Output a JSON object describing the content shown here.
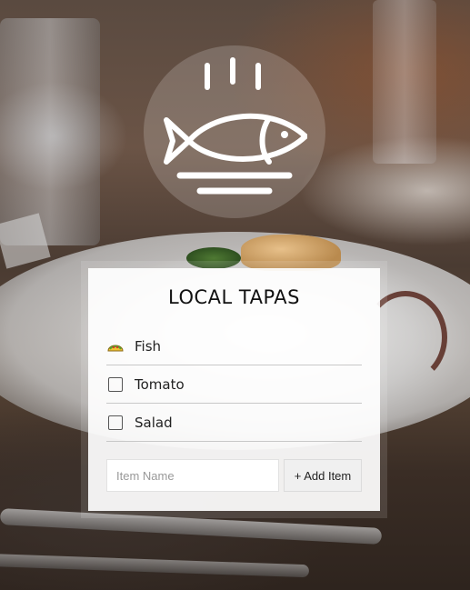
{
  "app": {
    "title": "LOCAL TAPAS"
  },
  "list": {
    "items": [
      {
        "label": "Fish",
        "checked": true,
        "icon": "taco-icon"
      },
      {
        "label": "Tomato",
        "checked": false
      },
      {
        "label": "Salad",
        "checked": false
      }
    ]
  },
  "form": {
    "input_placeholder": "Item Name",
    "input_value": "",
    "add_button_label": "+ Add Item"
  },
  "logo": {
    "icon": "fish-dish-icon"
  }
}
